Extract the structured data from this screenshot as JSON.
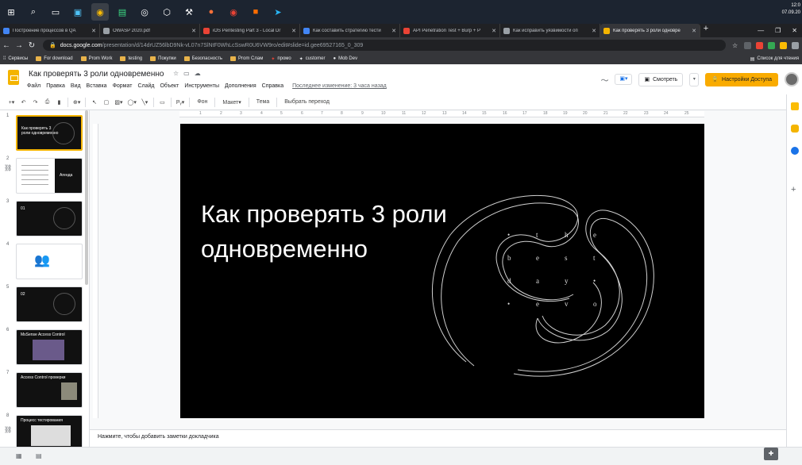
{
  "taskbar": {
    "clock": "12:0",
    "date": "07.09.20"
  },
  "browser": {
    "tabs": [
      {
        "label": "Построение процессов в QA",
        "color": "#4285f4"
      },
      {
        "label": "OWASP 2020.pdf",
        "color": "#9aa0a6"
      },
      {
        "label": "iOS Pentesting Part 3 - Local Dr",
        "color": "#ea4335"
      },
      {
        "label": "Как составить стратегию тести",
        "color": "#4285f4"
      },
      {
        "label": "API Penetration Test + Burp + P",
        "color": "#ea4335"
      },
      {
        "label": "Как исправить уязвимости оп",
        "color": "#9aa0a6"
      },
      {
        "label": "Как проверять 3 роли одновре",
        "color": "#f4b400",
        "active": true
      }
    ],
    "url_host": "docs.google.com",
    "url_path": "/presentation/d/14drUZ56lbD9Nk-vL07n7SlNtF0WhLcSswR0U6VW9ro/edit#slide=id.gee69527165_0_309",
    "bookmarks": [
      "Сервисы",
      "For download",
      "Prom Work",
      "testing",
      "Покупки",
      "Безопасность",
      "Prom Слам",
      "промо",
      "customer",
      "Mob Dev"
    ],
    "reading_list": "Список для чтения"
  },
  "app": {
    "doc_title": "Как проверять 3 роли одновременно",
    "menu": [
      "Файл",
      "Правка",
      "Вид",
      "Вставка",
      "Формат",
      "Слайд",
      "Объект",
      "Инструменты",
      "Дополнения",
      "Справка"
    ],
    "last_edit": "Последнее изменение: 3 часа назад",
    "present_label": "Смотреть",
    "share_label": "Настройки Доступа"
  },
  "toolbar": {
    "zoom_icon": "zoom-icon",
    "background_label": "Фон",
    "layout_label": "Макет",
    "theme_label": "Тема",
    "transition_label": "Выбрать переход"
  },
  "ruler": {
    "ticks": [
      "1",
      "2",
      "3",
      "4",
      "5",
      "6",
      "7",
      "8",
      "9",
      "10",
      "11",
      "12",
      "13",
      "14",
      "15",
      "16",
      "17",
      "18",
      "19",
      "20",
      "21",
      "22",
      "23",
      "24",
      "25"
    ]
  },
  "filmstrip": {
    "slides": [
      {
        "num": "1",
        "theme": "dark",
        "title": "Как проверять 3 роли одновременно",
        "selected": true
      },
      {
        "num": "2",
        "theme": "light",
        "title": "Агенда"
      },
      {
        "num": "3",
        "theme": "dark",
        "title": "01"
      },
      {
        "num": "4",
        "theme": "light",
        "title": ""
      },
      {
        "num": "5",
        "theme": "dark",
        "title": "02"
      },
      {
        "num": "6",
        "theme": "dark",
        "title": "MsSense Access Control"
      },
      {
        "num": "7",
        "theme": "dark",
        "title": "Access Control проверки"
      },
      {
        "num": "8",
        "theme": "dark",
        "title": "Процесс тестирования"
      }
    ]
  },
  "slide": {
    "title": "Как проверять 3 роли одновременно",
    "deco_rows": [
      [
        "•",
        "t",
        "h",
        "e"
      ],
      [
        "b",
        "e",
        "s",
        "t"
      ],
      [
        "d",
        "a",
        "y",
        "•"
      ],
      [
        "•",
        "e",
        "v",
        "o"
      ]
    ]
  },
  "notes": {
    "placeholder": "Нажмите, чтобы добавить заметки докладчика"
  }
}
